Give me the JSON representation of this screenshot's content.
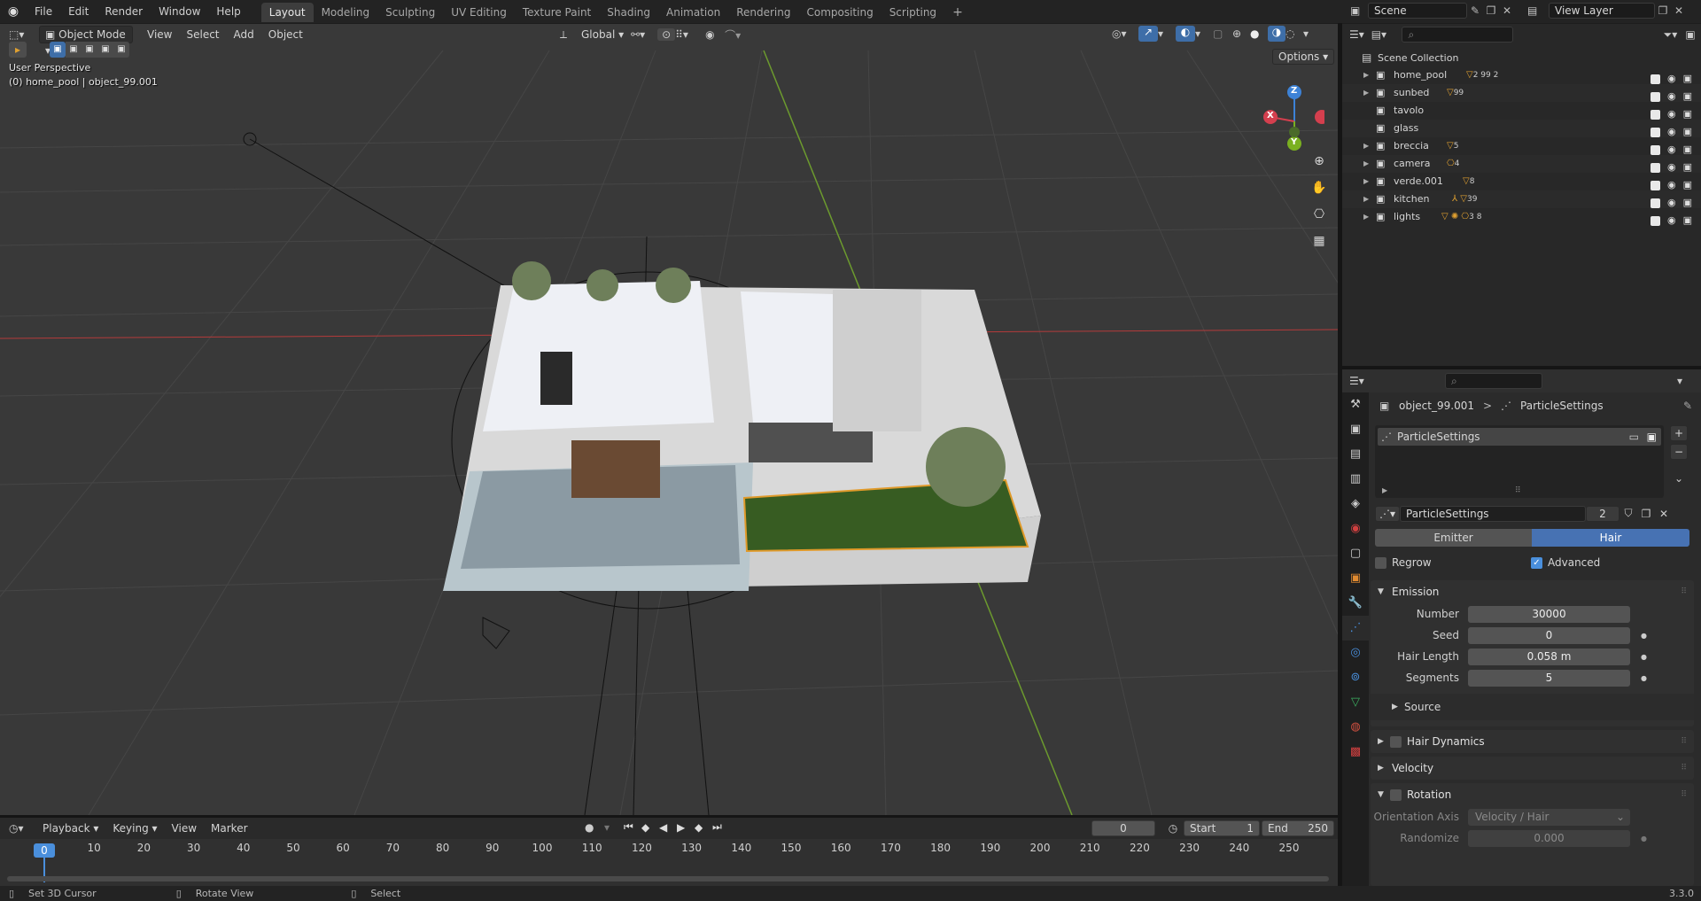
{
  "topbar": {
    "menus": [
      "File",
      "Edit",
      "Render",
      "Window",
      "Help"
    ],
    "workspaces": [
      "Layout",
      "Modeling",
      "Sculpting",
      "UV Editing",
      "Texture Paint",
      "Shading",
      "Animation",
      "Rendering",
      "Compositing",
      "Scripting"
    ],
    "active_workspace": "Layout",
    "add_tab": "+",
    "scene": "Scene",
    "view_layer": "View Layer"
  },
  "viewport": {
    "mode": "Object Mode",
    "menus": [
      "View",
      "Select",
      "Add",
      "Object"
    ],
    "transform_orientation": "Global",
    "options": "Options",
    "overlay_line1": "User Perspective",
    "overlay_line2": "(0) home_pool | object_99.001",
    "gizmo": {
      "z": "Z",
      "y": "Y",
      "x": "X"
    }
  },
  "outliner": {
    "root": "Scene Collection",
    "rows": [
      {
        "name": "home_pool",
        "badge": "2 99 2"
      },
      {
        "name": "sunbed",
        "badge": "99"
      },
      {
        "name": "tavolo",
        "badge": ""
      },
      {
        "name": "glass",
        "badge": ""
      },
      {
        "name": "breccia",
        "badge": "5"
      },
      {
        "name": "camera",
        "badge": "4"
      },
      {
        "name": "verde.001",
        "badge": "8"
      },
      {
        "name": "kitchen",
        "badge": "39"
      },
      {
        "name": "lights",
        "badge": "3 8"
      }
    ]
  },
  "properties": {
    "breadcrumb_object": "object_99.001",
    "breadcrumb_sep": ">",
    "breadcrumb_settings": "ParticleSettings",
    "list_item": "ParticleSettings",
    "datablock_name": "ParticleSettings",
    "datablock_users": "2",
    "type_emitter": "Emitter",
    "type_hair": "Hair",
    "regrow": "Regrow",
    "advanced": "Advanced",
    "emission": {
      "title": "Emission",
      "fields": [
        {
          "label": "Number",
          "value": "30000"
        },
        {
          "label": "Seed",
          "value": "0"
        },
        {
          "label": "Hair Length",
          "value": "0.058 m"
        },
        {
          "label": "Segments",
          "value": "5"
        }
      ],
      "source": "Source"
    },
    "hair_dynamics": "Hair Dynamics",
    "velocity": "Velocity",
    "rotation": {
      "title": "Rotation",
      "orientation_axis_label": "Orientation Axis",
      "orientation_axis_value": "Velocity / Hair",
      "randomize_label": "Randomize",
      "randomize_value": "0.000"
    }
  },
  "timeline": {
    "menus": [
      "Playback",
      "Keying",
      "View",
      "Marker"
    ],
    "current_frame": "0",
    "start_label": "Start",
    "start": "1",
    "end_label": "End",
    "end": "250",
    "ticks": [
      "0",
      "10",
      "20",
      "30",
      "40",
      "50",
      "60",
      "70",
      "80",
      "90",
      "100",
      "110",
      "120",
      "130",
      "140",
      "150",
      "160",
      "170",
      "180",
      "190",
      "200",
      "210",
      "220",
      "230",
      "240",
      "250"
    ]
  },
  "statusbar": {
    "left": "Set 3D Cursor",
    "middle": "Rotate View",
    "right": "Select",
    "version": "3.3.0"
  }
}
